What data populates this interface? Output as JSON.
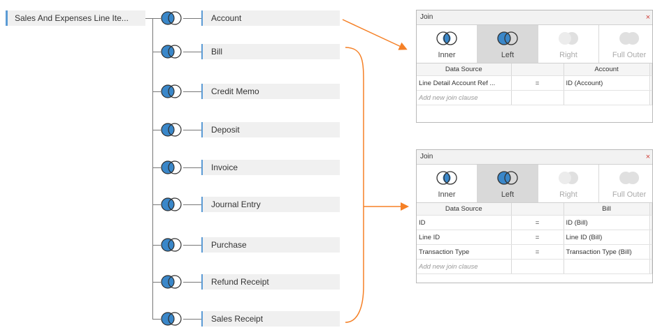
{
  "left_table": {
    "label": "Sales And Expenses Line Ite..."
  },
  "right_tables": [
    {
      "label": "Account"
    },
    {
      "label": "Bill"
    },
    {
      "label": "Credit Memo"
    },
    {
      "label": "Deposit"
    },
    {
      "label": "Invoice"
    },
    {
      "label": "Journal Entry"
    },
    {
      "label": "Purchase"
    },
    {
      "label": "Refund Receipt"
    },
    {
      "label": "Sales Receipt"
    }
  ],
  "colors": {
    "accent": "#5b9bd5",
    "arrow": "#f58026",
    "join_blue": "#3a87c9"
  },
  "dialogs": [
    {
      "title": "Join",
      "close": "×",
      "types": [
        "Inner",
        "Left",
        "Right",
        "Full Outer"
      ],
      "selected": "Left",
      "headers": [
        "Data Source",
        "",
        "Account"
      ],
      "rows": [
        [
          "Line Detail Account Ref ...",
          "=",
          "ID (Account)"
        ]
      ],
      "add_clause": "Add new join clause"
    },
    {
      "title": "Join",
      "close": "×",
      "types": [
        "Inner",
        "Left",
        "Right",
        "Full Outer"
      ],
      "selected": "Left",
      "headers": [
        "Data Source",
        "",
        "Bill"
      ],
      "rows": [
        [
          "ID",
          "=",
          "ID (Bill)"
        ],
        [
          "Line ID",
          "=",
          "Line ID (Bill)"
        ],
        [
          "Transaction Type",
          "=",
          "Transaction Type (Bill)"
        ]
      ],
      "add_clause": "Add new join clause"
    }
  ]
}
